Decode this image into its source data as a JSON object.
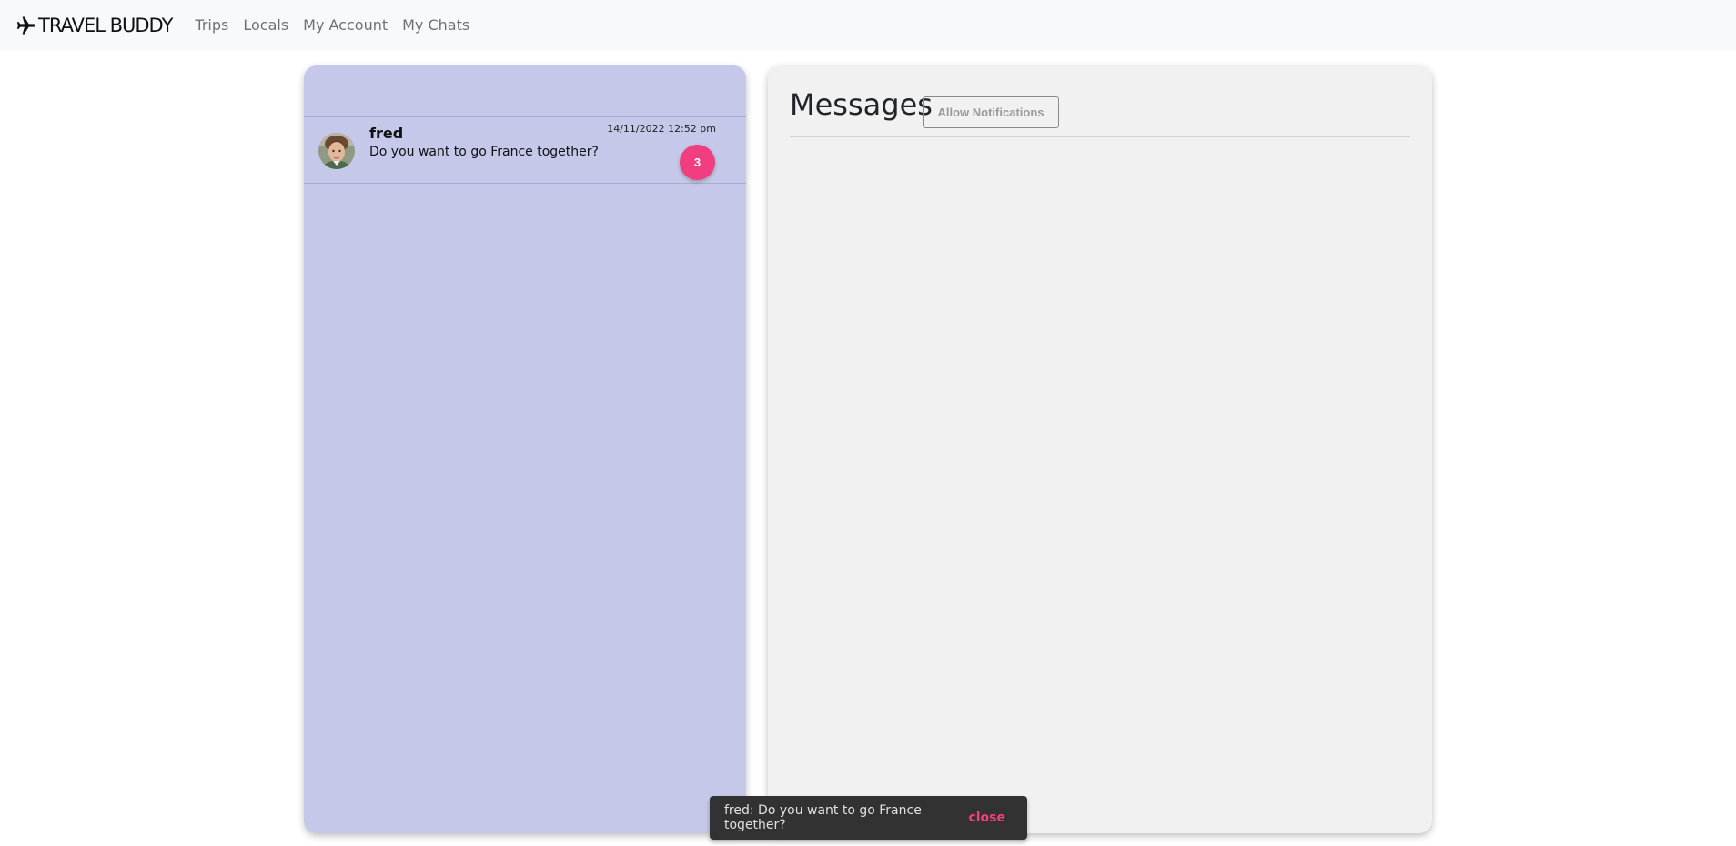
{
  "navbar": {
    "brand": "TRAVEL BUDDY",
    "brand_icon": "airplane-icon",
    "links": [
      "Trips",
      "Locals",
      "My Account",
      "My Chats"
    ]
  },
  "chat_list": {
    "items": [
      {
        "name": "fred",
        "preview": "Do you want to go France together?",
        "timestamp": "14/11/2022 12:52 pm",
        "unread_count": "3",
        "avatar": "user-avatar"
      }
    ]
  },
  "messages": {
    "title": "Messages",
    "allow_notifications_label": "Allow Notifications"
  },
  "snackbar": {
    "text": "fred: Do you want to go France together?",
    "close_label": "close"
  },
  "colors": {
    "navbar_bg": "#f8f9fa",
    "chat_list_bg": "#c5c8e8",
    "messages_bg": "#f1f1f1",
    "accent_pink": "#f03e80",
    "snackbar_bg": "#323232"
  }
}
